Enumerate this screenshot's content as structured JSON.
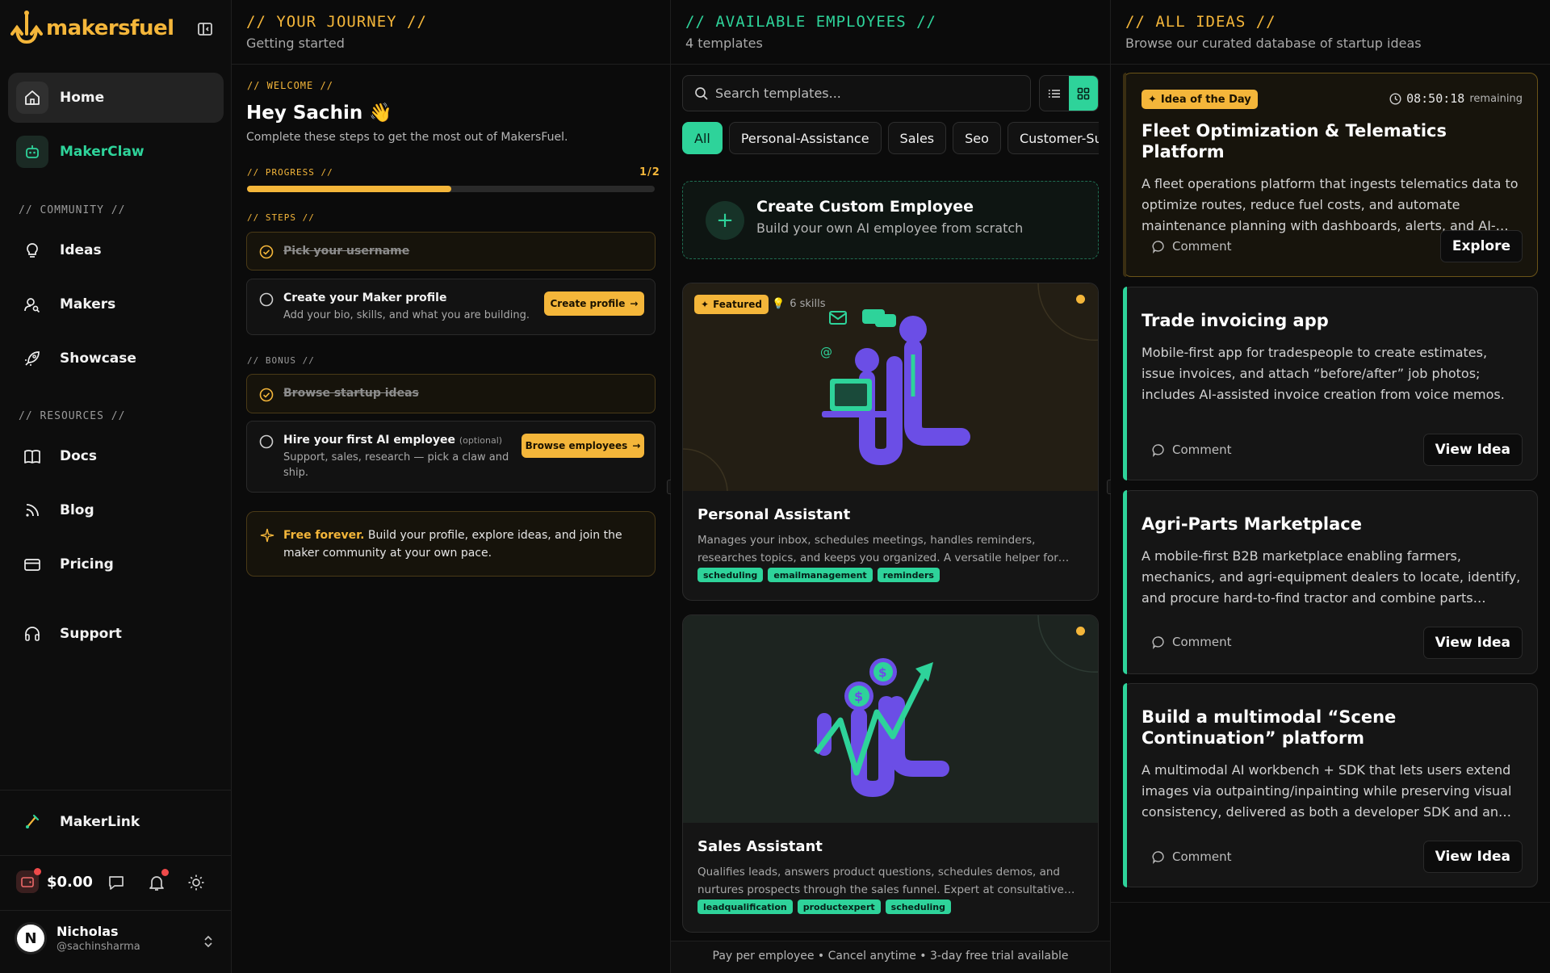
{
  "brand": {
    "name": "makersfuel"
  },
  "sidebar": {
    "items_top": [
      {
        "label": "Home"
      },
      {
        "label": "MakerClaw"
      }
    ],
    "community_label": "// COMMUNITY //",
    "community": [
      {
        "label": "Ideas"
      },
      {
        "label": "Makers"
      },
      {
        "label": "Showcase"
      }
    ],
    "resources_label": "// RESOURCES //",
    "resources": [
      {
        "label": "Docs"
      },
      {
        "label": "Blog"
      },
      {
        "label": "Pricing"
      }
    ],
    "support_label": "Support",
    "makerlink_label": "MakerLink",
    "wallet_amount": "$0.00",
    "user": {
      "initial": "N",
      "name": "Nicholas",
      "handle": "@sachinsharma"
    }
  },
  "journey": {
    "title": "// YOUR JOURNEY //",
    "subtitle": "Getting started",
    "welcome_tag": "// WELCOME //",
    "greeting": "Hey Sachin 👋",
    "intro": "Complete these steps to get the most out of MakersFuel.",
    "progress_label": "// PROGRESS //",
    "progress_text": "1/2",
    "progress_fraction": 0.5,
    "steps_label": "// STEPS //",
    "steps": [
      {
        "title": "Pick your username",
        "done": true
      },
      {
        "title": "Create your Maker profile",
        "desc": "Add your bio, skills, and what you are building.",
        "button": "Create profile"
      }
    ],
    "bonus_label": "// BONUS //",
    "bonus": [
      {
        "title": "Browse startup ideas",
        "done": true
      },
      {
        "title": "Hire your first AI employee",
        "optional": "(optional)",
        "desc": "Support, sales, research — pick a claw and ship.",
        "button": "Browse employees"
      }
    ],
    "free_bold": "Free forever.",
    "free_text": " Build your profile, explore ideas, and join the maker community at your own pace."
  },
  "employees": {
    "title": "// AVAILABLE EMPLOYEES //",
    "subtitle": "4 templates",
    "search_placeholder": "Search templates...",
    "chips": [
      "All",
      "Personal-Assistance",
      "Sales",
      "Seo",
      "Customer-Support"
    ],
    "custom": {
      "title": "Create Custom Employee",
      "desc": "Build your own AI employee from scratch"
    },
    "cards": [
      {
        "featured": "Featured",
        "skills": "6 skills",
        "name": "Personal Assistant",
        "desc": "Manages your inbox, schedules meetings, handles reminders, researches topics, and keeps you organized. A versatile helper for…",
        "tags": [
          "scheduling",
          "emailmanagement",
          "reminders"
        ]
      },
      {
        "name": "Sales Assistant",
        "desc": "Qualifies leads, answers product questions, schedules demos, and nurtures prospects through the sales funnel. Expert at consultative…",
        "tags": [
          "leadqualification",
          "productexpert",
          "scheduling"
        ]
      }
    ],
    "footer": "Pay per employee • Cancel anytime • 3-day free trial available"
  },
  "ideas": {
    "title": "// ALL IDEAS //",
    "subtitle": "Browse our curated database of startup ideas",
    "iotd_label": "Idea of the Day",
    "timer": "08:50:18",
    "timer_suffix": "remaining",
    "comment_label": "Comment",
    "items": [
      {
        "title": "Fleet Optimization & Telematics Platform",
        "desc": "A fleet operations platform that ingests telematics data to optimize routes, reduce fuel costs, and automate maintenance planning with dashboards, alerts, and AI-…",
        "button": "Explore"
      },
      {
        "title": "Trade invoicing app",
        "desc": "Mobile-first app for tradespeople to create estimates, issue invoices, and attach “before/after” job photos; includes AI-assisted invoice creation from voice memos.",
        "button": "View Idea"
      },
      {
        "title": "Agri-Parts Marketplace",
        "desc": "A mobile-first B2B marketplace enabling farmers, mechanics, and agri-equipment dealers to locate, identify, and procure hard-to-find tractor and combine parts…",
        "button": "View Idea"
      },
      {
        "title": "Build a multimodal “Scene Continuation” platform",
        "desc": "A multimodal AI workbench + SDK that lets users extend images via outpainting/inpainting while preserving visual consistency, delivered as both a developer SDK and an…",
        "button": "View Idea"
      }
    ]
  },
  "colors": {
    "accent_yellow": "#f4b63a",
    "accent_green": "#2ed39a",
    "bg": "#0b0b0b"
  }
}
